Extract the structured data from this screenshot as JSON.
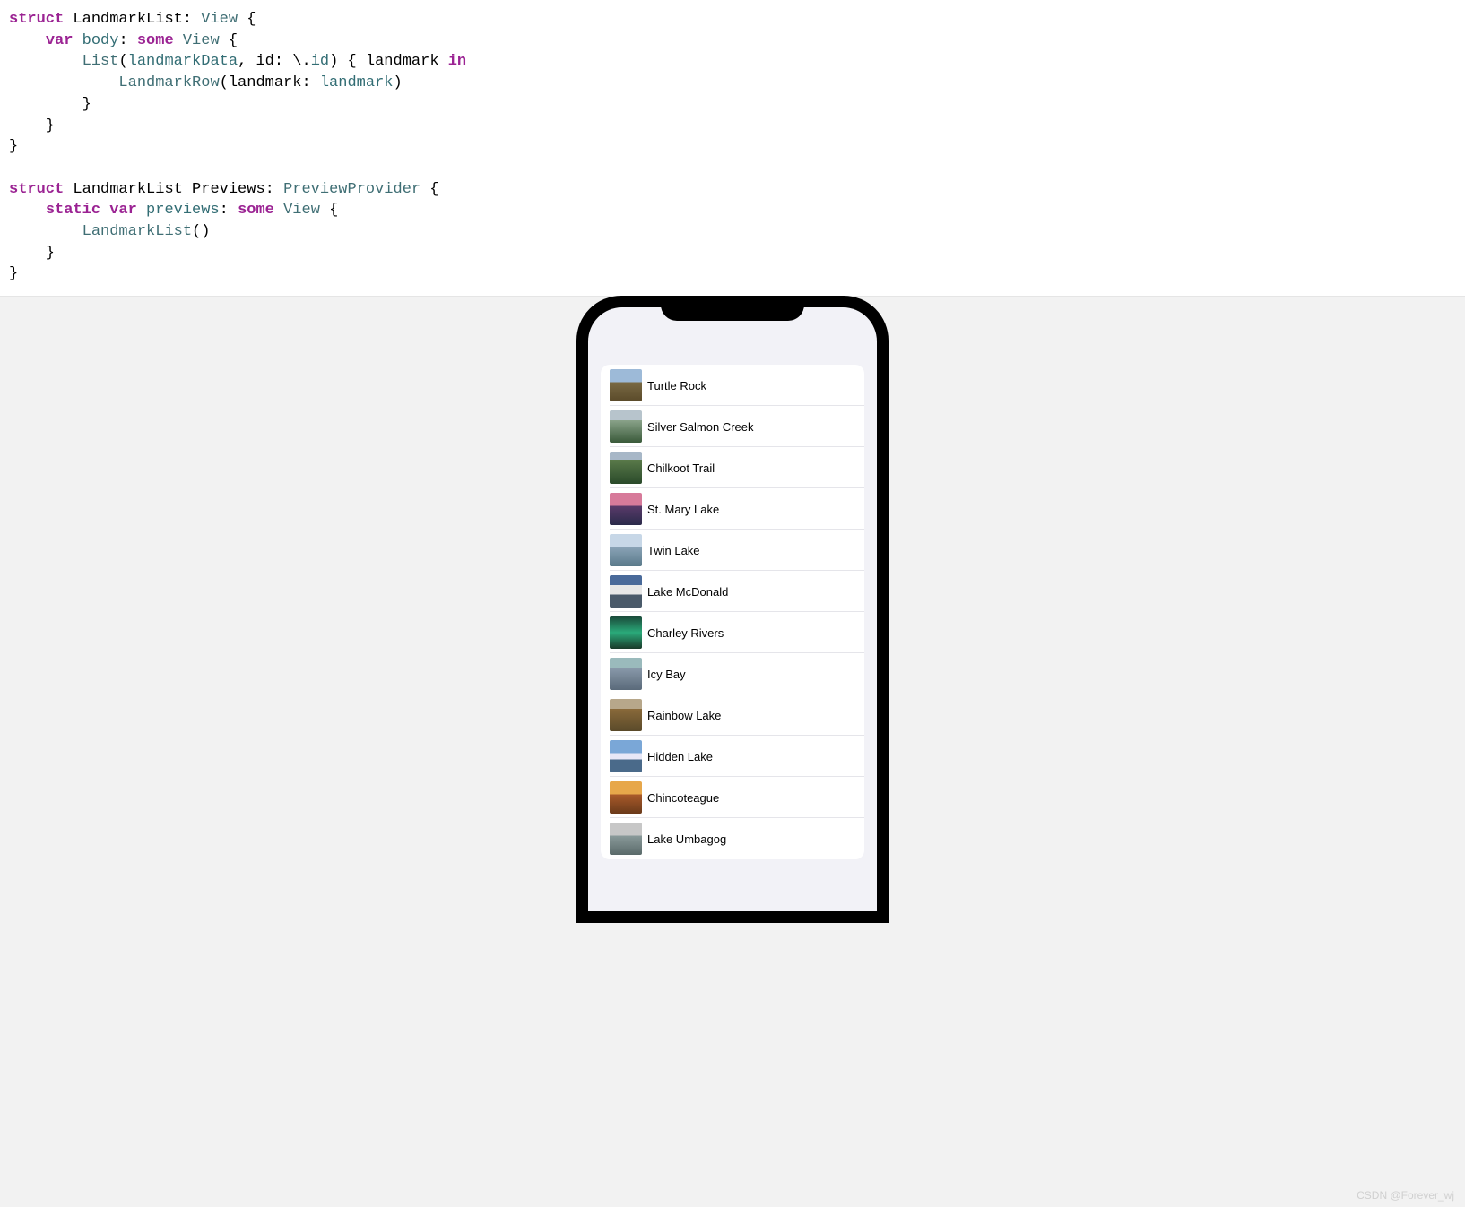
{
  "code": {
    "l1_struct": "struct",
    "l1_name": "LandmarkList",
    "l1_colon": ": ",
    "l1_view": "View",
    "l1_brace": " {",
    "l2_var": "var",
    "l2_body": "body",
    "l2_colon": ": ",
    "l2_some": "some",
    "l2_view": "View",
    "l2_brace": " {",
    "l3_list": "List",
    "l3_open": "(",
    "l3_data": "landmarkData",
    "l3_mid": ", id: \\.",
    "l3_id": "id",
    "l3_close": ") { ",
    "l3_landmark": "landmark ",
    "l3_in": "in",
    "l4_row": "LandmarkRow",
    "l4_open": "(landmark: ",
    "l4_arg": "landmark",
    "l4_close": ")",
    "p_struct": "struct",
    "p_name": "LandmarkList_Previews",
    "p_colon": ": ",
    "p_provider": "PreviewProvider",
    "p_brace": " {",
    "p_static": "static",
    "p_var": "var",
    "p_previews": "previews",
    "p_colon2": ": ",
    "p_some": "some",
    "p_view": "View",
    "p_brace2": " {",
    "p_call": "LandmarkList",
    "p_call_close": "()"
  },
  "landmarks": [
    {
      "name": "Turtle Rock"
    },
    {
      "name": "Silver Salmon Creek"
    },
    {
      "name": "Chilkoot Trail"
    },
    {
      "name": "St. Mary Lake"
    },
    {
      "name": "Twin Lake"
    },
    {
      "name": "Lake McDonald"
    },
    {
      "name": "Charley Rivers"
    },
    {
      "name": "Icy Bay"
    },
    {
      "name": "Rainbow Lake"
    },
    {
      "name": "Hidden Lake"
    },
    {
      "name": "Chincoteague"
    },
    {
      "name": "Lake Umbagog"
    }
  ],
  "watermark": "CSDN @Forever_wj"
}
